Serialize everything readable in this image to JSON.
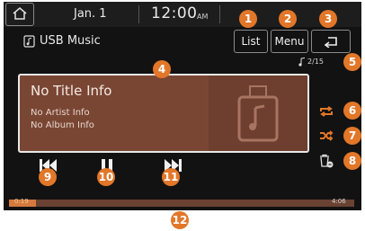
{
  "topbar": {
    "date": "Jan. 1",
    "time": "12:00",
    "ampm": "AM"
  },
  "header": {
    "source": "USB Music",
    "list_label": "List",
    "menu_label": "Menu"
  },
  "track": {
    "counter": "2/15",
    "title": "No Title Info",
    "artist": "No Artist Info",
    "album": "No Album Info"
  },
  "progress": {
    "elapsed": "0:19",
    "total": "4:06",
    "fraction": 0.077
  },
  "colors": {
    "accent": "#e27729",
    "panel": "#7a4634",
    "progress_fill": "#d47a3e",
    "background": "#121212"
  },
  "icons": [
    "home-icon",
    "usb-music-icon",
    "back-icon",
    "note-icon",
    "repeat-icon",
    "shuffle-icon",
    "delete-file-icon",
    "previous-icon",
    "pause-icon",
    "next-icon"
  ],
  "callouts": [
    "1",
    "2",
    "3",
    "4",
    "5",
    "6",
    "7",
    "8",
    "9",
    "10",
    "11",
    "12"
  ]
}
